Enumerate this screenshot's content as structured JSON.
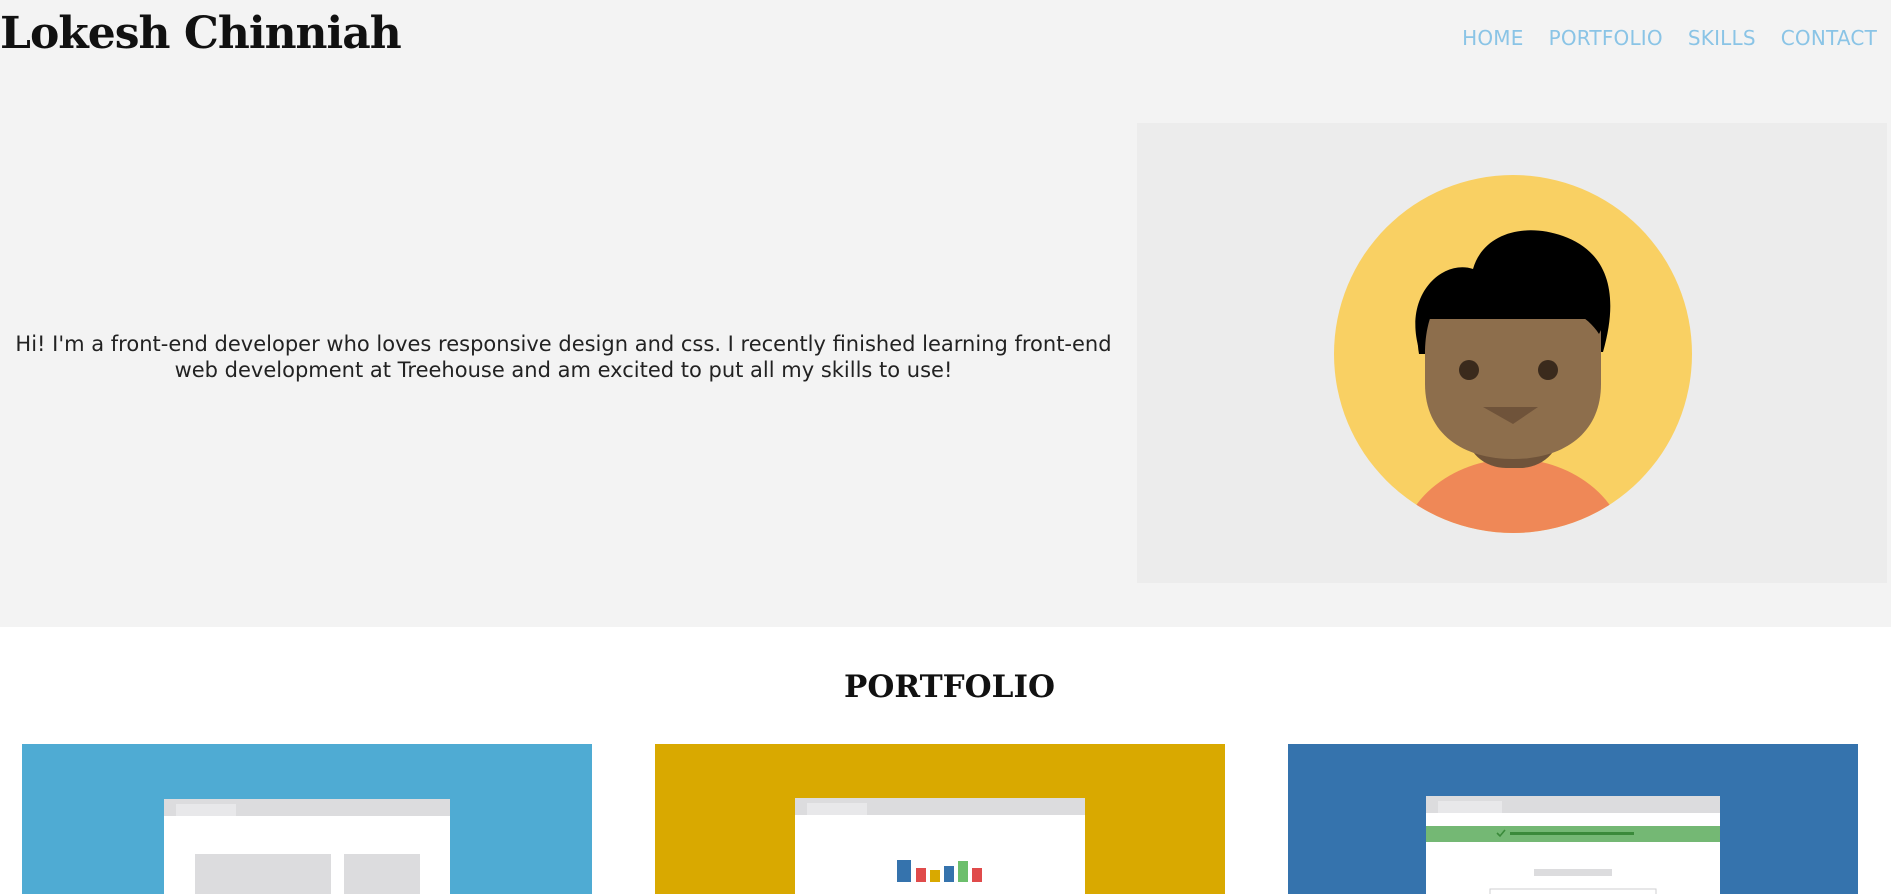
{
  "header": {
    "site_title": "Lokesh Chinniah",
    "nav": [
      "HOME",
      "PORTFOLIO",
      "SKILLS",
      "CONTACT"
    ]
  },
  "intro": {
    "text": "Hi! I'm a front-end developer who loves responsive design and css. I recently finished learning front-end web development at Treehouse and am excited to put all my skills to use!"
  },
  "avatar": {
    "icon": "person-avatar-icon",
    "circle_color": "#f9d063",
    "skin_color": "#8d6e4c",
    "hair_color": "#000000",
    "shirt_color": "#ef8857",
    "panel_color": "#ececec"
  },
  "portfolio": {
    "heading": "PORTFOLIO",
    "cards": [
      {
        "background": "#4fabd3",
        "icon": "layout-mockup-icon"
      },
      {
        "background": "#d9a900",
        "icon": "bar-chart-mockup-icon"
      },
      {
        "background": "#3573ad",
        "icon": "form-success-mockup-icon"
      }
    ]
  },
  "colors": {
    "page_background": "#f3f3f3",
    "nav_link": "#8ac4e6"
  }
}
